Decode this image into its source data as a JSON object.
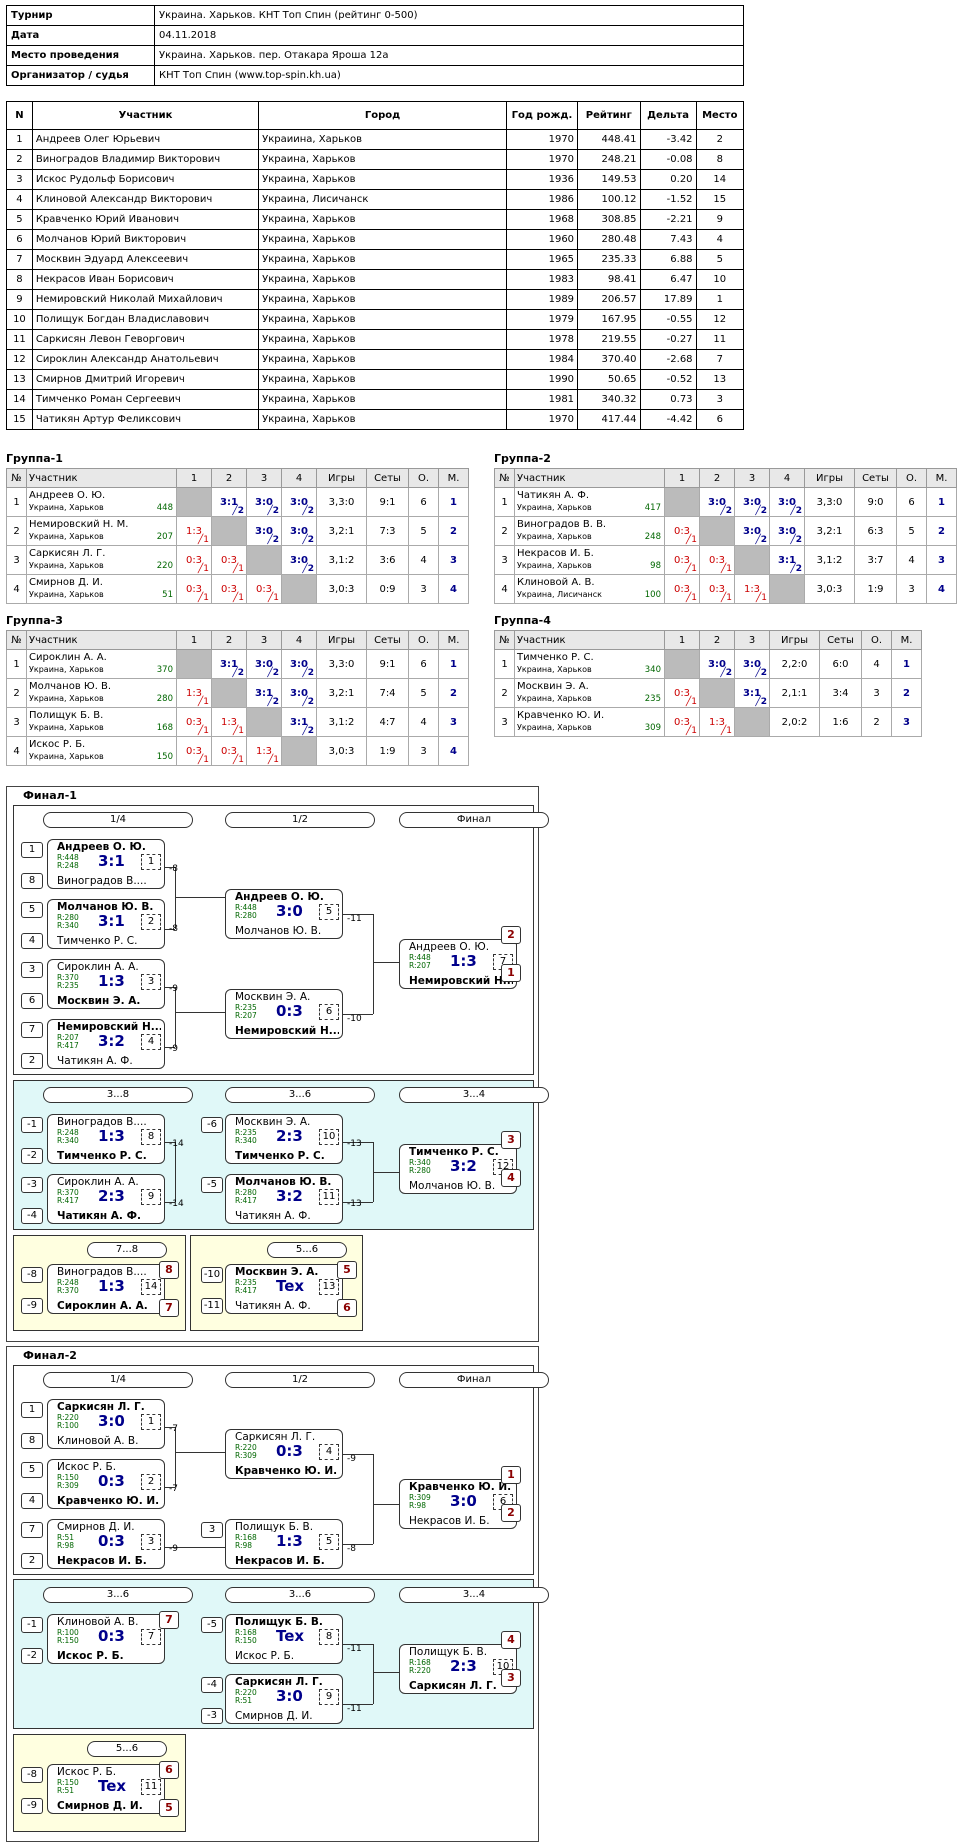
{
  "info": [
    [
      "Турнир",
      "Украина. Харьков. КНТ Топ Спин (рейтинг 0-500)"
    ],
    [
      "Дата",
      "04.11.2018"
    ],
    [
      "Место проведения",
      "Украина. Харьков. пер. Отакара Яроша 12а"
    ],
    [
      "Организатор / судья",
      "КНТ Топ Спин (www.top-spin.kh.ua)"
    ]
  ],
  "parts_head": [
    "N",
    "Участник",
    "Город",
    "Год рожд.",
    "Рейтинг",
    "Дельта",
    "Место"
  ],
  "parts": [
    [
      "1",
      "Андреев Олег Юрьевич",
      "Украиина, Харьков",
      "1970",
      "448.41",
      "-3.42",
      "2"
    ],
    [
      "2",
      "Виноградов Владимир Викторович",
      "Украина, Харьков",
      "1970",
      "248.21",
      "-0.08",
      "8"
    ],
    [
      "3",
      "Искос Рудольф Борисович",
      "Украина, Харьков",
      "1936",
      "149.53",
      "0.20",
      "14"
    ],
    [
      "4",
      "Клиновой Александр Викторович",
      "Украина, Лисичанск",
      "1986",
      "100.12",
      "-1.52",
      "15"
    ],
    [
      "5",
      "Кравченко Юрий Иванович",
      "Украина, Харьков",
      "1968",
      "308.85",
      "-2.21",
      "9"
    ],
    [
      "6",
      "Молчанов Юрий Викторович",
      "Украина, Харьков",
      "1960",
      "280.48",
      "7.43",
      "4"
    ],
    [
      "7",
      "Москвин Эдуард Алексеевич",
      "Украина, Харьков",
      "1965",
      "235.33",
      "6.88",
      "5"
    ],
    [
      "8",
      "Некрасов Иван Борисович",
      "Украина, Харьков",
      "1983",
      "98.41",
      "6.47",
      "10"
    ],
    [
      "9",
      "Немировский Николай Михайлович",
      "Украина, Харьков",
      "1989",
      "206.57",
      "17.89",
      "1"
    ],
    [
      "10",
      "Полищук Богдан Владиславович",
      "Украина, Харьков",
      "1979",
      "167.95",
      "-0.55",
      "12"
    ],
    [
      "11",
      "Саркисян Левон Геворгович",
      "Украина, Харьков",
      "1978",
      "219.55",
      "-0.27",
      "11"
    ],
    [
      "12",
      "Сироклин Александр Анатольевич",
      "Украина, Харьков",
      "1984",
      "370.40",
      "-2.68",
      "7"
    ],
    [
      "13",
      "Смирнов Дмитрий Игоревич",
      "Украина, Харьков",
      "1990",
      "50.65",
      "-0.52",
      "13"
    ],
    [
      "14",
      "Тимченко Роман Сергеевич",
      "Украина, Харьков",
      "1981",
      "340.32",
      "0.73",
      "3"
    ],
    [
      "15",
      "Чатикян Артур Феликсович",
      "Украина, Харьков",
      "1970",
      "417.44",
      "-4.42",
      "6"
    ]
  ],
  "group_head": {
    "num": "№",
    "name": "Участник",
    "games": "Игры",
    "sets": "Сеты",
    "o": "О.",
    "m": "М."
  },
  "groups": [
    {
      "title": "Группа-1",
      "rows": [
        {
          "n": "1",
          "name": "Андреев О. Ю.",
          "city": "Украина, Харьков",
          "r": "448",
          "s": [
            null,
            "3:1|2",
            "3:0|2",
            "3:0|2"
          ],
          "games": "3,3:0",
          "sets": "9:1",
          "o": "6",
          "m": "1"
        },
        {
          "n": "2",
          "name": "Немировский Н. М.",
          "city": "Украина, Харьков",
          "r": "207",
          "s": [
            "1:3|1",
            null,
            "3:0|2",
            "3:0|2"
          ],
          "games": "3,2:1",
          "sets": "7:3",
          "o": "5",
          "m": "2"
        },
        {
          "n": "3",
          "name": "Саркисян Л. Г.",
          "city": "Украина, Харьков",
          "r": "220",
          "s": [
            "0:3|1",
            "0:3|1",
            null,
            "3:0|2"
          ],
          "games": "3,1:2",
          "sets": "3:6",
          "o": "4",
          "m": "3"
        },
        {
          "n": "4",
          "name": "Смирнов Д. И.",
          "city": "Украина, Харьков",
          "r": "51",
          "s": [
            "0:3|1",
            "0:3|1",
            "0:3|1",
            null
          ],
          "games": "3,0:3",
          "sets": "0:9",
          "o": "3",
          "m": "4"
        }
      ]
    },
    {
      "title": "Группа-2",
      "rows": [
        {
          "n": "1",
          "name": "Чатикян А. Ф.",
          "city": "Украина, Харьков",
          "r": "417",
          "s": [
            null,
            "3:0|2",
            "3:0|2",
            "3:0|2"
          ],
          "games": "3,3:0",
          "sets": "9:0",
          "o": "6",
          "m": "1"
        },
        {
          "n": "2",
          "name": "Виноградов В. В.",
          "city": "Украина, Харьков",
          "r": "248",
          "s": [
            "0:3|1",
            null,
            "3:0|2",
            "3:0|2"
          ],
          "games": "3,2:1",
          "sets": "6:3",
          "o": "5",
          "m": "2"
        },
        {
          "n": "3",
          "name": "Некрасов И. Б.",
          "city": "Украина, Харьков",
          "r": "98",
          "s": [
            "0:3|1",
            "0:3|1",
            null,
            "3:1|2"
          ],
          "games": "3,1:2",
          "sets": "3:7",
          "o": "4",
          "m": "3"
        },
        {
          "n": "4",
          "name": "Клиновой А. В.",
          "city": "Украина, Лисичанск",
          "r": "100",
          "s": [
            "0:3|1",
            "0:3|1",
            "1:3|1",
            null
          ],
          "games": "3,0:3",
          "sets": "1:9",
          "o": "3",
          "m": "4"
        }
      ]
    },
    {
      "title": "Группа-3",
      "rows": [
        {
          "n": "1",
          "name": "Сироклин А. А.",
          "city": "Украина, Харьков",
          "r": "370",
          "s": [
            null,
            "3:1|2",
            "3:0|2",
            "3:0|2"
          ],
          "games": "3,3:0",
          "sets": "9:1",
          "o": "6",
          "m": "1"
        },
        {
          "n": "2",
          "name": "Молчанов Ю. В.",
          "city": "Украина, Харьков",
          "r": "280",
          "s": [
            "1:3|1",
            null,
            "3:1|2",
            "3:0|2"
          ],
          "games": "3,2:1",
          "sets": "7:4",
          "o": "5",
          "m": "2"
        },
        {
          "n": "3",
          "name": "Полищук Б. В.",
          "city": "Украина, Харьков",
          "r": "168",
          "s": [
            "0:3|1",
            "1:3|1",
            null,
            "3:1|2"
          ],
          "games": "3,1:2",
          "sets": "4:7",
          "o": "4",
          "m": "3"
        },
        {
          "n": "4",
          "name": "Искос Р. Б.",
          "city": "Украина, Харьков",
          "r": "150",
          "s": [
            "0:3|1",
            "0:3|1",
            "1:3|1",
            null
          ],
          "games": "3,0:3",
          "sets": "1:9",
          "o": "3",
          "m": "4"
        }
      ]
    },
    {
      "title": "Группа-4",
      "rows": [
        {
          "n": "1",
          "name": "Тимченко Р. С.",
          "city": "Украина, Харьков",
          "r": "340",
          "s": [
            null,
            "3:0|2",
            "3:0|2"
          ],
          "games": "2,2:0",
          "sets": "6:0",
          "o": "4",
          "m": "1"
        },
        {
          "n": "2",
          "name": "Москвин Э. А.",
          "city": "Украина, Харьков",
          "r": "235",
          "s": [
            "0:3|1",
            null,
            "3:1|2"
          ],
          "games": "2,1:1",
          "sets": "3:4",
          "o": "3",
          "m": "2"
        },
        {
          "n": "3",
          "name": "Кравченко Ю. И.",
          "city": "Украина, Харьков",
          "r": "309",
          "s": [
            "0:3|1",
            "1:3|1",
            null
          ],
          "games": "2,0:2",
          "sets": "1:6",
          "o": "2",
          "m": "3"
        }
      ]
    }
  ],
  "final1": {
    "title": "Финал-1",
    "pills": [
      "1/4",
      "1/2",
      "Финал",
      "3...8",
      "3...6",
      "3...4",
      "7...8",
      "5...6"
    ],
    "seeds": [
      "1",
      "8",
      "5",
      "4",
      "3",
      "6",
      "7",
      "2",
      "-1",
      "-2",
      "-3",
      "-4",
      "-6",
      "-5",
      "-8",
      "-9",
      "-10",
      "-11"
    ],
    "labels": [
      "-8",
      "-8",
      "-9",
      "-9",
      "-11",
      "-10",
      "-14",
      "-14",
      "-13",
      "-13"
    ],
    "places": [
      "2",
      "1",
      "3",
      "4",
      "8",
      "7",
      "5",
      "6"
    ],
    "matches": [
      {
        "p1": "Андреев О. Ю.",
        "p2": "Виноградов В....",
        "r1": "R:448",
        "r2": "R:248",
        "sc": "3:1",
        "n": "1",
        "w": 1
      },
      {
        "p1": "Молчанов Ю. В.",
        "p2": "Тимченко Р. С.",
        "r1": "R:280",
        "r2": "R:340",
        "sc": "3:1",
        "n": "2",
        "w": 1
      },
      {
        "p1": "Сироклин А. А.",
        "p2": "Москвин Э. А.",
        "r1": "R:370",
        "r2": "R:235",
        "sc": "1:3",
        "n": "3",
        "w": 2
      },
      {
        "p1": "Немировский Н....",
        "p2": "Чатикян А. Ф.",
        "r1": "R:207",
        "r2": "R:417",
        "sc": "3:2",
        "n": "4",
        "w": 1
      },
      {
        "p1": "Андреев О. Ю.",
        "p2": "Молчанов Ю. В.",
        "r1": "R:448",
        "r2": "R:280",
        "sc": "3:0",
        "n": "5",
        "w": 1
      },
      {
        "p1": "Москвин Э. А.",
        "p2": "Немировский Н....",
        "r1": "R:235",
        "r2": "R:207",
        "sc": "0:3",
        "n": "6",
        "w": 2
      },
      {
        "p1": "Андреев О. Ю.",
        "p2": "Немировский Н....",
        "r1": "R:448",
        "r2": "R:207",
        "sc": "1:3",
        "n": "7",
        "w": 2
      },
      {
        "p1": "Виноградов В....",
        "p2": "Тимченко Р. С.",
        "r1": "R:248",
        "r2": "R:340",
        "sc": "1:3",
        "n": "8",
        "w": 2
      },
      {
        "p1": "Сироклин А. А.",
        "p2": "Чатикян А. Ф.",
        "r1": "R:370",
        "r2": "R:417",
        "sc": "2:3",
        "n": "9",
        "w": 2
      },
      {
        "p1": "Москвин Э. А.",
        "p2": "Тимченко Р. С.",
        "r1": "R:235",
        "r2": "R:340",
        "sc": "2:3",
        "n": "10",
        "w": 2
      },
      {
        "p1": "Молчанов Ю. В.",
        "p2": "Чатикян А. Ф.",
        "r1": "R:280",
        "r2": "R:417",
        "sc": "3:2",
        "n": "11",
        "w": 1
      },
      {
        "p1": "Тимченко Р. С.",
        "p2": "Молчанов Ю. В.",
        "r1": "R:340",
        "r2": "R:280",
        "sc": "3:2",
        "n": "12",
        "w": 1
      },
      {
        "p1": "Виноградов В....",
        "p2": "Сироклин А. А.",
        "r1": "R:248",
        "r2": "R:370",
        "sc": "1:3",
        "n": "14",
        "w": 2
      },
      {
        "p1": "Москвин Э. А.",
        "p2": "Чатикян А. Ф.",
        "r1": "R:235",
        "r2": "R:417",
        "sc": "Tex",
        "n": "13",
        "w": 1
      }
    ]
  },
  "final2": {
    "title": "Финал-2",
    "pills": [
      "1/4",
      "1/2",
      "Финал",
      "3...6",
      "3...6",
      "3...4",
      "5...6"
    ],
    "seeds": [
      "1",
      "8",
      "5",
      "4",
      "7",
      "2",
      "3",
      "-1",
      "-2",
      "-5",
      "-4",
      "-3",
      "-8",
      "-9"
    ],
    "labels": [
      "-7",
      "-7",
      "-9",
      "-9",
      "-8",
      "-11",
      "-11"
    ],
    "places": [
      "1",
      "2",
      "7",
      "4",
      "3",
      "6",
      "5"
    ],
    "matches": [
      {
        "p1": "Саркисян Л. Г.",
        "p2": "Клиновой А. В.",
        "r1": "R:220",
        "r2": "R:100",
        "sc": "3:0",
        "n": "1",
        "w": 1
      },
      {
        "p1": "Искос Р. Б.",
        "p2": "Кравченко Ю. И.",
        "r1": "R:150",
        "r2": "R:309",
        "sc": "0:3",
        "n": "2",
        "w": 2
      },
      {
        "p1": "Смирнов Д. И.",
        "p2": "Некрасов И. Б.",
        "r1": "R:51",
        "r2": "R:98",
        "sc": "0:3",
        "n": "3",
        "w": 2
      },
      {
        "p1": "Саркисян Л. Г.",
        "p2": "Кравченко Ю. И.",
        "r1": "R:220",
        "r2": "R:309",
        "sc": "0:3",
        "n": "4",
        "w": 2
      },
      {
        "p1": "Полищук Б. В.",
        "p2": "Некрасов И. Б.",
        "r1": "R:168",
        "r2": "R:98",
        "sc": "1:3",
        "n": "5",
        "w": 2
      },
      {
        "p1": "Кравченко Ю. И.",
        "p2": "Некрасов И. Б.",
        "r1": "R:309",
        "r2": "R:98",
        "sc": "3:0",
        "n": "6",
        "w": 1
      },
      {
        "p1": "Клиновой А. В.",
        "p2": "Искос Р. Б.",
        "r1": "R:100",
        "r2": "R:150",
        "sc": "0:3",
        "n": "7",
        "w": 2
      },
      {
        "p1": "Полищук Б. В.",
        "p2": "Искос Р. Б.",
        "r1": "R:168",
        "r2": "R:150",
        "sc": "Tex",
        "n": "8",
        "w": 1
      },
      {
        "p1": "Саркисян Л. Г.",
        "p2": "Смирнов Д. И.",
        "r1": "R:220",
        "r2": "R:51",
        "sc": "3:0",
        "n": "9",
        "w": 1
      },
      {
        "p1": "Полищук Б. В.",
        "p2": "Саркисян Л. Г.",
        "r1": "R:168",
        "r2": "R:220",
        "sc": "2:3",
        "n": "10",
        "w": 2
      },
      {
        "p1": "Искос Р. Б.",
        "p2": "Смирнов Д. И.",
        "r1": "R:150",
        "r2": "R:51",
        "sc": "Tex",
        "n": "11",
        "w": 2
      }
    ]
  }
}
